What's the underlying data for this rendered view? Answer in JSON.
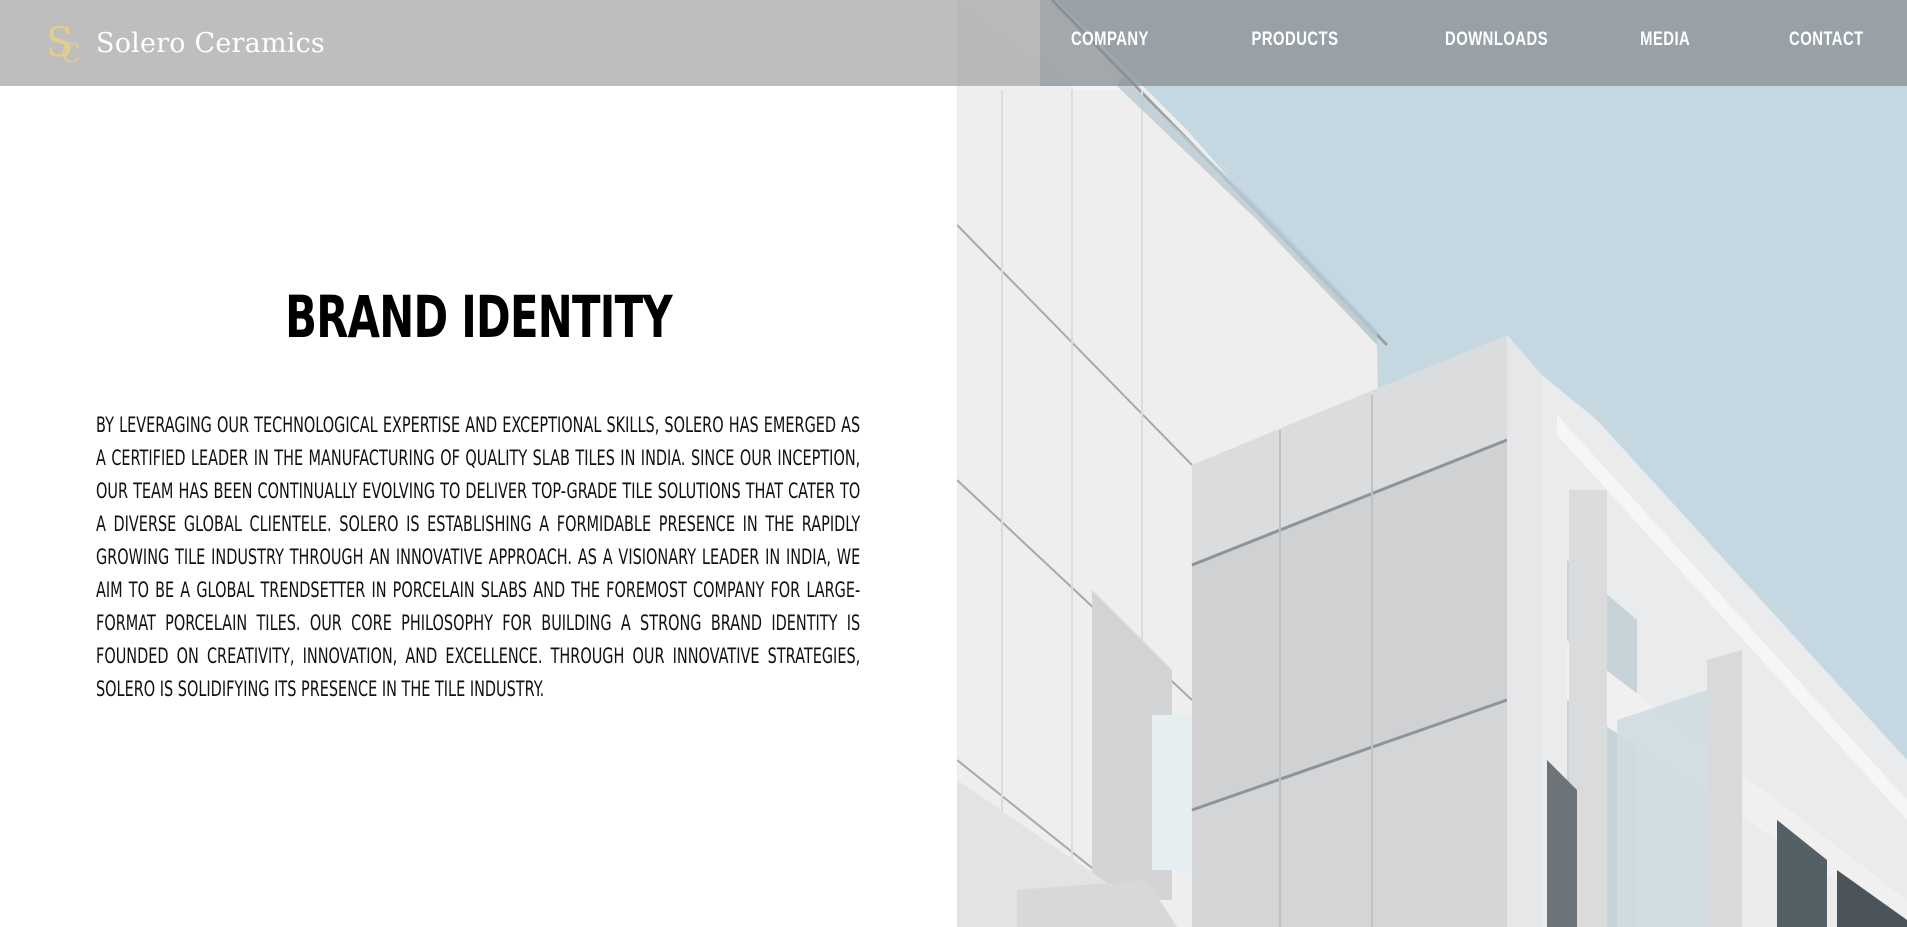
{
  "brand": {
    "logo_text": "Solero Ceramics",
    "logo_mark": "SC",
    "accent_color": "#e3cf8a"
  },
  "nav": {
    "items": [
      {
        "label": "COMPANY"
      },
      {
        "label": "PRODUCTS"
      },
      {
        "label": "DOWNLOADS"
      },
      {
        "label": "MEDIA"
      },
      {
        "label": "CONTACT"
      }
    ]
  },
  "main": {
    "heading": "BRAND IDENTITY",
    "body": "By leveraging our technological expertise and exceptional skills, Solero has emerged as a certified leader in the manufacturing of quality slab tiles in India. Since our inception, our team has been continually evolving to deliver top-grade tile solutions that cater to a diverse global clientele. Solero is establishing a formidable presence in the rapidly growing tile industry through an innovative approach. As a visionary leader in India, we aim to be a global trendsetter in porcelain slabs and the foremost company for large-format porcelain tiles. Our core philosophy for building a strong brand identity is founded on creativity, innovation, and excellence. Through our innovative strategies, Solero is solidifying its presence in the tile industry."
  },
  "hero": {
    "image": "white-building-facade",
    "sky_color": "#c5d8e1"
  }
}
